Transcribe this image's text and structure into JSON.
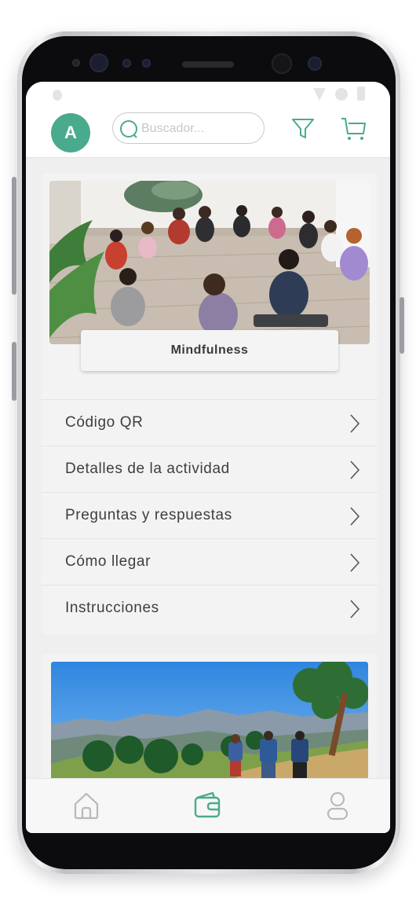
{
  "search": {
    "placeholder": "Buscador..."
  },
  "header": {
    "avatar_letter": "A"
  },
  "activity": {
    "title": "Mindfulness",
    "menu": [
      {
        "label": "Código QR"
      },
      {
        "label": "Detalles de la actividad"
      },
      {
        "label": "Preguntas y respuestas"
      },
      {
        "label": "Cómo llegar"
      },
      {
        "label": "Instrucciones"
      }
    ]
  },
  "icons": {
    "filter": "filter-icon",
    "cart": "cart-icon",
    "home": "home-icon",
    "wallet": "wallet-icon",
    "profile": "user-icon",
    "search": "search-icon",
    "chevron": "chevron-right-icon"
  },
  "colors": {
    "accent": "#4aaa8e",
    "nav_inactive": "#b9b9b9",
    "text": "#3e3e3e"
  },
  "bottom_nav": {
    "active": "wallet"
  }
}
